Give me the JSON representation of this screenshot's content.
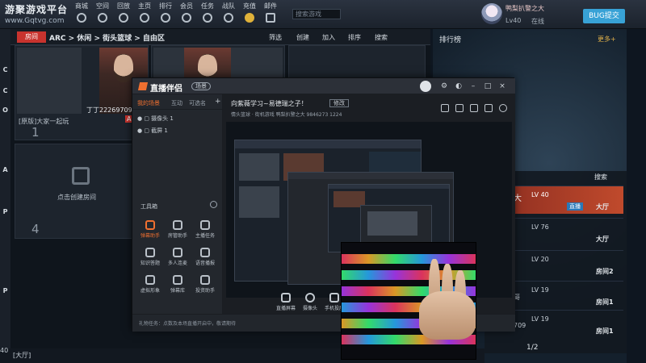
{
  "platform": {
    "title": "游聚游戏平台",
    "url": "www.Gqtvg.com",
    "nav": [
      "商城",
      "空间",
      "回放",
      "主页",
      "排行",
      "会员",
      "任务",
      "战队",
      "充值",
      "邮件"
    ],
    "search_placeholder": "搜索游戏",
    "user": {
      "name": "鸭梨扒警之大",
      "level": "Lv40",
      "status": "在线"
    },
    "bug_button": "BUG提交",
    "left_strip": [
      "C",
      "C",
      "O",
      "A",
      "P",
      "P"
    ],
    "room_tab": "房间",
    "breadcrumb": "ARC > 休闲 > 街头篮球 > 自由区",
    "room_actions": [
      "筛选",
      "创建",
      "加入",
      "排序",
      "搜索"
    ],
    "rooms": [
      {
        "number": "1",
        "caption": "[原版]大家一起玩",
        "host": "丁丁22269709",
        "badge": "A"
      },
      {
        "number": "",
        "caption": "",
        "host": "",
        "badge": ""
      },
      {
        "number": "4",
        "caption": "点击创建房间",
        "host": "",
        "badge": ""
      }
    ],
    "rank": {
      "title": "排行榜",
      "more": "更多+"
    },
    "right_search": "搜索",
    "right_rows": [
      {
        "level": "LV 40",
        "name": "大",
        "hall": "大厅"
      },
      {
        "level": "LV 76",
        "name": "",
        "hall": "大厅"
      },
      {
        "level": "LV 20",
        "name": "",
        "hall": "房间2"
      },
      {
        "level": "LV 19",
        "name": "哥",
        "hall": "房间1"
      },
      {
        "level": "LV 19",
        "name": "709",
        "hall": "房间1"
      }
    ],
    "right_tag": "直播",
    "pager": "1/2",
    "status_text": "[大厅]",
    "status_num": "40"
  },
  "companion": {
    "app_name": "直播伴侣",
    "scene_label": "场景",
    "window_controls": [
      "–",
      "□",
      "×"
    ],
    "tabs": [
      "我的场景",
      "互动",
      "可选名"
    ],
    "add_label": "+",
    "sources": [
      "摄像头 1",
      "截屏 1"
    ],
    "toolbox_label": "工具箱",
    "tools": [
      "弹幕助手",
      "房管助手",
      "主播任务",
      "知识答题",
      "多人连麦",
      "语音播报",
      "虚拟形象",
      "弹幕库",
      "投资助手"
    ],
    "stream_title": "向紫薇学习~易德瑞之子！",
    "modify_label": "修改",
    "meta": "情头篮球 · 街机游戏   鸭梨扒警之大   9846273   1224",
    "bottom_buttons": [
      "直播屏幕",
      "摄像头",
      "手机投屏"
    ],
    "tip": "礼物任务：点数及本场直播开启中，敬请期待",
    "colors": {
      "accent": "#f07030",
      "bug": "#38a2d6",
      "room_tab": "#c8332e"
    }
  }
}
